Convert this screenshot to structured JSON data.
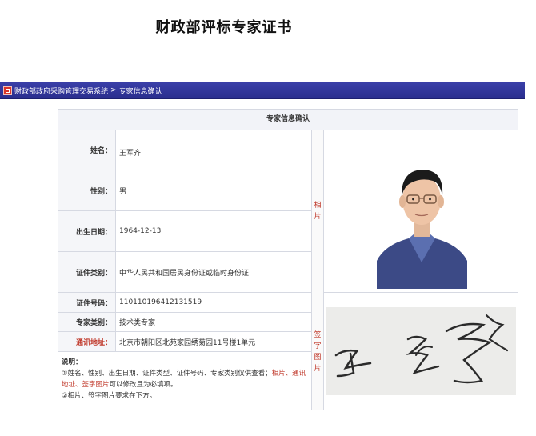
{
  "doc_title": "财政部评标专家证书",
  "nav": {
    "system": "财政部政府采购管理交易系统",
    "separator": ">",
    "current": "专家信息确认"
  },
  "card": {
    "header": "专家信息确认",
    "fields": [
      {
        "label": "姓名：",
        "value": "王军齐"
      },
      {
        "label": "性别：",
        "value": "男"
      },
      {
        "label": "出生日期：",
        "value": "1964-12-13"
      },
      {
        "label": "证件类别：",
        "value": "中华人民共和国居民身份证或临时身份证"
      },
      {
        "label": "证件号码：",
        "value": "110110196412131519"
      },
      {
        "label": "专家类别：",
        "value": "技术类专家"
      },
      {
        "label": "通讯地址：",
        "value": "北京市朝阳区北苑家园绣菊园11号楼1单元"
      }
    ],
    "photo_label": [
      "相",
      "片"
    ],
    "sign_label": [
      "签",
      "字",
      "图",
      "片"
    ],
    "notes": {
      "title": "说明：",
      "line1_a": "①姓名、性别、出生日期、证件类型、证件号码、专家类别仅供查看；",
      "line1_b": "相片、通讯地址、签字图片",
      "line1_c": "可以修改且为必填项。",
      "line2": "②相片、签字图片要求在下方。"
    }
  },
  "colors": {
    "nav_bg": "#2a2e8e",
    "accent_red": "#c0392b",
    "header_bg": "#f2f3f8"
  }
}
